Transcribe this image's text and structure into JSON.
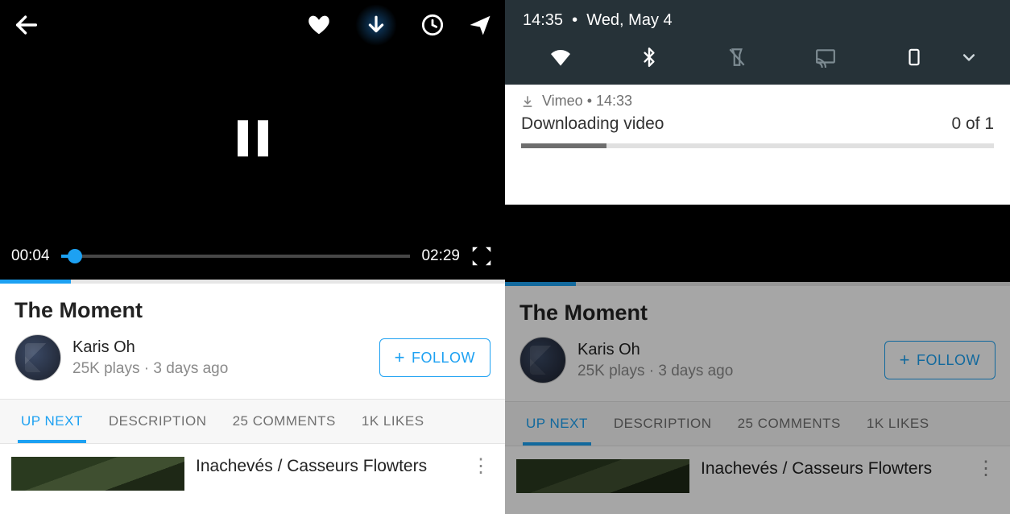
{
  "player": {
    "elapsed": "00:04",
    "duration": "02:29"
  },
  "video": {
    "title": "The Moment",
    "uploader_name": "Karis Oh",
    "plays": "25K plays",
    "age": "3 days ago",
    "follow_label": "FOLLOW"
  },
  "tabs": {
    "upnext": "UP NEXT",
    "description": "DESCRIPTION",
    "comments": "25 COMMENTS",
    "likes": "1K LIKES"
  },
  "upnext_item": {
    "title": "Inachevés / Casseurs Flowters"
  },
  "notif_shade": {
    "time": "14:35",
    "date": "Wed, May 4"
  },
  "notification": {
    "app": "Vimeo",
    "time": "14:33",
    "title": "Downloading video",
    "count": "0 of 1"
  }
}
